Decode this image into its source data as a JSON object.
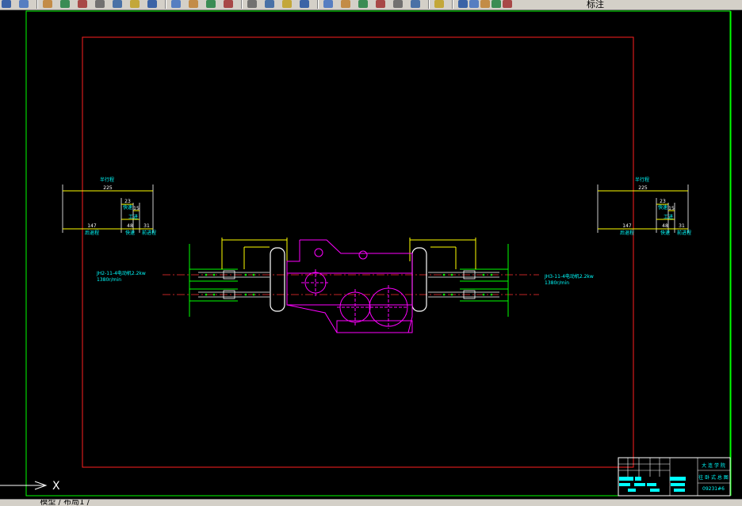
{
  "toolbar": {
    "layer_name": "标注",
    "icons": [
      "undo-icon",
      "save-icon",
      "plot-icon",
      "print-preview-icon",
      "publish-icon",
      "paint-icon",
      "cut-icon",
      "copy-icon",
      "paste-icon",
      "match-properties-icon",
      "block-icon",
      "undo-arrow-icon",
      "redo-arrow-icon",
      "pan-icon",
      "zoom-realtime-icon",
      "zoom-window-icon",
      "zoom-previous-icon",
      "properties-icon",
      "design-center-icon",
      "tool-palette-icon",
      "sheet-set-icon",
      "markup-icon",
      "calculator-icon",
      "help-icon",
      "layer-manager-icon",
      "bulb-icon",
      "sun-icon",
      "lock-icon",
      "layer-color-icon"
    ]
  },
  "drawing": {
    "left_view": {
      "total_label": "半行程",
      "dim_total": "225",
      "dim_a": "23",
      "dim_b": "15",
      "dim_c": "147",
      "dim_d": "48",
      "dim_e": "31",
      "label_fast": "快速",
      "label_work": "工进",
      "label_retreat_left": "后退程",
      "label_forward": "快速",
      "label_front": "前进程"
    },
    "right_view": {
      "total_label": "半行程",
      "dim_total": "225",
      "dim_a": "23",
      "dim_b": "15",
      "dim_c": "147",
      "dim_d": "48",
      "dim_e": "31",
      "label_fast": "快速",
      "label_work": "工进",
      "label_retreat_left": "后退程",
      "label_forward": "快速",
      "label_front": "前进程"
    },
    "motor_left_line1": "JH2-11-4电动机2.2kw",
    "motor_left_line2": "1380r/min",
    "motor_right_line1": "JH3-11-4电动机2.2kw",
    "motor_right_line2": "1380r/min",
    "title_block": {
      "school": "大 连 学 院",
      "title": "往 卧 式 总 图",
      "code": "09231#6"
    }
  },
  "ucs": {
    "x_label": "X"
  },
  "statusbar": {
    "tabs_text": "  模型 / 布局1 /"
  },
  "colors": {
    "frame_green": "#00ff00",
    "border_red": "#ff0000",
    "dimension_yellow": "#ffff00",
    "text_cyan": "#00ffff",
    "part_magenta": "#ff00ff",
    "centerline_red": "#ff0000",
    "line_white": "#ffffff"
  }
}
